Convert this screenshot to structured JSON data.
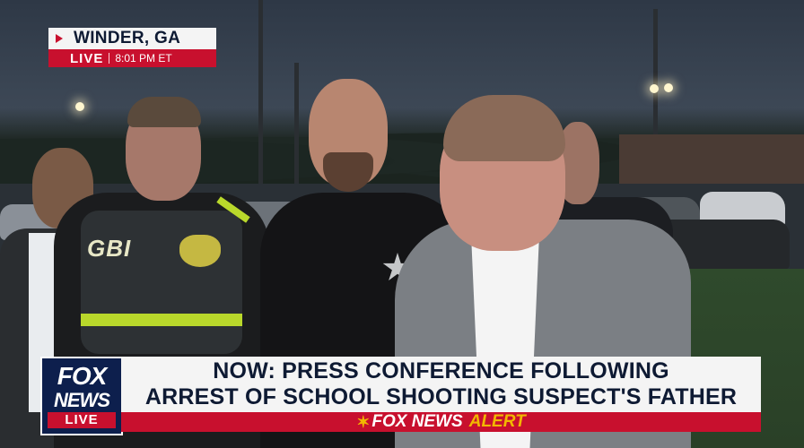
{
  "location_bug": {
    "city": "WINDER, GA",
    "live_label": "LIVE",
    "time": "8:01 PM ET"
  },
  "logo": {
    "line1": "FOX",
    "line2": "NEWS",
    "live_label": "LIVE"
  },
  "headline": {
    "line1": "NOW: PRESS CONFERENCE FOLLOWING",
    "line2": "ARREST OF SCHOOL SHOOTING SUSPECT'S FATHER"
  },
  "alert_bar": {
    "brand": "FOX NEWS",
    "alert": "ALERT"
  },
  "scene": {
    "vest_text": "GBI"
  },
  "colors": {
    "fox_red": "#c8102e",
    "fox_navy": "#0d1f4d",
    "alert_gold": "#f2b800"
  }
}
